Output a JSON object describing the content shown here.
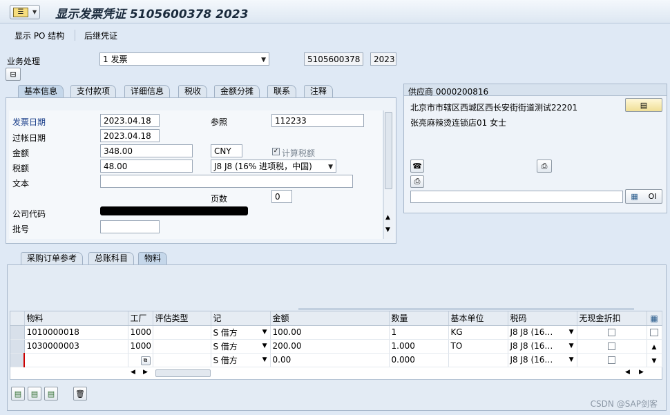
{
  "title": "显示发票凭证 5105600378 2023",
  "toolbar": {
    "po_structure": "显示 PO 结构",
    "follow_on": "后继凭证"
  },
  "header": {
    "transaction_label": "业务处理",
    "transaction_value": "1 发票",
    "doc_number": "5105600378",
    "fiscal_year": "2023"
  },
  "top_tabs": [
    "基本信息",
    "支付款项",
    "详细信息",
    "税收",
    "金额分摊",
    "联系",
    "注释"
  ],
  "basic": {
    "invoice_date_label": "发票日期",
    "invoice_date": "2023.04.18",
    "reference_label": "参照",
    "reference": "112233",
    "posting_date_label": "过帐日期",
    "posting_date": "2023.04.18",
    "amount_label": "金额",
    "amount": "348.00",
    "currency": "CNY",
    "calc_tax_label": "计算税额",
    "tax_label": "税额",
    "tax": "48.00",
    "tax_code": "J8 J8 (16% 进项税，中国)",
    "text_label": "文本",
    "page_label": "页数",
    "page": "0",
    "company_code_label": "公司代码",
    "batch_label": "批号"
  },
  "vendor": {
    "header": "供应商 0000200816",
    "address_line1": "北京市市辖区西城区西长安街街道测试22201",
    "address_line2": "张亮麻辣烫连锁店01 女士",
    "oi_label": "OI"
  },
  "bottom_tabs": [
    "采购订单参考",
    "总账科目",
    "物料"
  ],
  "table": {
    "columns": [
      "物料",
      "工厂",
      "评估类型",
      "记",
      "金额",
      "数量",
      "基本单位",
      "税码",
      "无现金折扣"
    ],
    "rows": [
      {
        "material": "1010000018",
        "plant": "1000",
        "val_type": "",
        "dc": "S 借方",
        "amount": "100.00",
        "qty": "1",
        "unit": "KG",
        "tax": "J8 J8 (16…"
      },
      {
        "material": "1030000003",
        "plant": "1000",
        "val_type": "",
        "dc": "S 借方",
        "amount": "200.00",
        "qty": "1.000",
        "unit": "TO",
        "tax": "J8 J8 (16…"
      },
      {
        "material": "",
        "plant": "",
        "val_type": "",
        "dc": "S 借方",
        "amount": "0.00",
        "qty": "0.000",
        "unit": "",
        "tax": "J8 J8 (16…"
      }
    ]
  },
  "watermark": "CSDN @SAP剑客"
}
